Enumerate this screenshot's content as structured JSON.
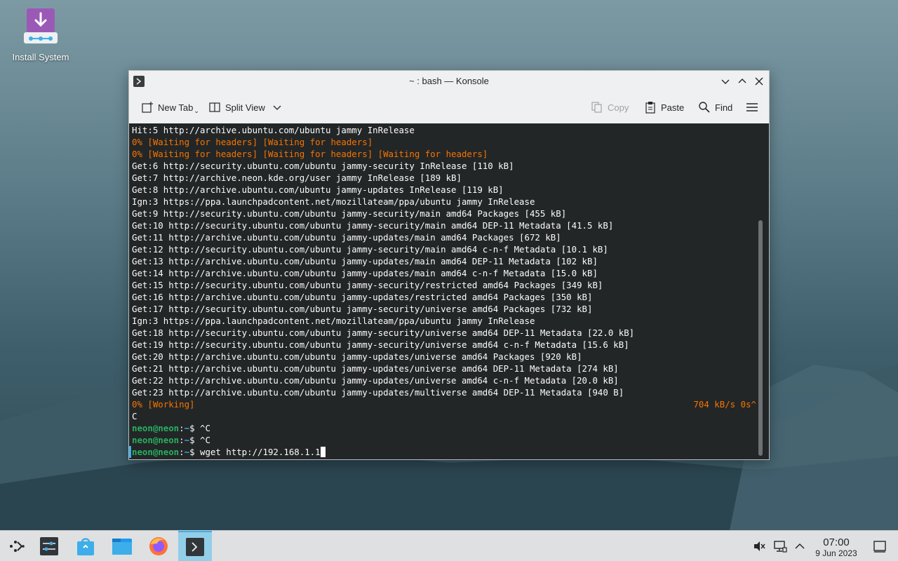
{
  "desktop": {
    "install_icon_label": "Install System"
  },
  "window": {
    "title": "~ : bash — Konsole",
    "toolbar": {
      "new_tab": "New Tab",
      "split_view": "Split View",
      "copy": "Copy",
      "paste": "Paste",
      "find": "Find"
    }
  },
  "terminal": {
    "lines": [
      "Hit:5 http://archive.ubuntu.com/ubuntu jammy InRelease",
      "0% [Waiting for headers] [Waiting for headers]",
      "0% [Waiting for headers] [Waiting for headers] [Waiting for headers]",
      "Get:6 http://security.ubuntu.com/ubuntu jammy-security InRelease [110 kB]",
      "Get:7 http://archive.neon.kde.org/user jammy InRelease [189 kB]",
      "Get:8 http://archive.ubuntu.com/ubuntu jammy-updates InRelease [119 kB]",
      "Ign:3 https://ppa.launchpadcontent.net/mozillateam/ppa/ubuntu jammy InRelease",
      "Get:9 http://security.ubuntu.com/ubuntu jammy-security/main amd64 Packages [455 kB]",
      "Get:10 http://security.ubuntu.com/ubuntu jammy-security/main amd64 DEP-11 Metadata [41.5 kB]",
      "Get:11 http://archive.ubuntu.com/ubuntu jammy-updates/main amd64 Packages [672 kB]",
      "Get:12 http://security.ubuntu.com/ubuntu jammy-security/main amd64 c-n-f Metadata [10.1 kB]",
      "Get:13 http://archive.ubuntu.com/ubuntu jammy-updates/main amd64 DEP-11 Metadata [102 kB]",
      "Get:14 http://archive.ubuntu.com/ubuntu jammy-updates/main amd64 c-n-f Metadata [15.0 kB]",
      "Get:15 http://security.ubuntu.com/ubuntu jammy-security/restricted amd64 Packages [349 kB]",
      "Get:16 http://archive.ubuntu.com/ubuntu jammy-updates/restricted amd64 Packages [350 kB]",
      "Get:17 http://security.ubuntu.com/ubuntu jammy-security/universe amd64 Packages [732 kB]",
      "Ign:3 https://ppa.launchpadcontent.net/mozillateam/ppa/ubuntu jammy InRelease",
      "Get:18 http://security.ubuntu.com/ubuntu jammy-security/universe amd64 DEP-11 Metadata [22.0 kB]",
      "Get:19 http://security.ubuntu.com/ubuntu jammy-security/universe amd64 c-n-f Metadata [15.6 kB]",
      "Get:20 http://archive.ubuntu.com/ubuntu jammy-updates/universe amd64 Packages [920 kB]",
      "Get:21 http://archive.ubuntu.com/ubuntu jammy-updates/universe amd64 DEP-11 Metadata [274 kB]",
      "Get:22 http://archive.ubuntu.com/ubuntu jammy-updates/universe amd64 c-n-f Metadata [20.0 kB]",
      "Get:23 http://archive.ubuntu.com/ubuntu jammy-updates/multiverse amd64 DEP-11 Metadata [940 B]"
    ],
    "progress_left": "0% [Working]",
    "progress_right": "704 kB/s 0s^",
    "interrupt_line": "C",
    "prompt_user": "neon@neon",
    "prompt_sep": ":",
    "prompt_path": "~",
    "prompt_symbol": "$ ",
    "cmd_1": "^C",
    "cmd_2": "^C",
    "cmd_current": "wget http://192.168.1.1"
  },
  "taskbar": {
    "clock_time": "07:00",
    "clock_date": "9 Jun 2023"
  },
  "colors": {
    "terminal_bg": "#232627",
    "terminal_fg": "#fcfcfc",
    "warn": "#f67400",
    "prompt_user": "#27ae60",
    "prompt_path": "#3daee9",
    "accent": "#3daee9"
  },
  "icons": [
    "download-icon",
    "konsole-icon",
    "new-tab-icon",
    "split-view-icon",
    "copy-icon",
    "paste-icon",
    "find-icon",
    "hamburger-menu-icon",
    "app-launcher-icon",
    "system-settings-icon",
    "discover-store-icon",
    "dolphin-files-icon",
    "firefox-icon",
    "volume-muted-icon",
    "network-icon",
    "tray-expand-icon",
    "show-desktop-icon"
  ]
}
